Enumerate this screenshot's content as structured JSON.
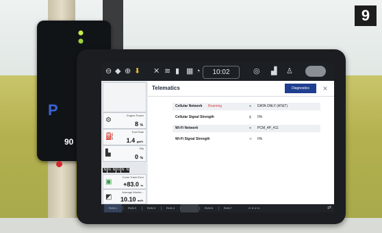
{
  "badge": {
    "number": "9"
  },
  "side_display": {
    "gear": "P",
    "speed": "90"
  },
  "topbar": {
    "icons": [
      "speedometer-icon",
      "info-icon",
      "gps-icon",
      "arrow-down-icon",
      "wrench-icon",
      "wifi-icon",
      "signal-bars-icon",
      "grid-icon",
      "timer-icon"
    ],
    "clock": "10:02"
  },
  "left_panel": {
    "engine_power": {
      "label": "Engine Power",
      "value": "8",
      "unit": "%"
    },
    "fuel_rate": {
      "label": "Fuel Rate",
      "value": "1.4",
      "unit": "gal/h"
    },
    "slip": {
      "label": "Slip",
      "value": "0",
      "unit": "%"
    },
    "gear_row_top": [
      "N",
      "N",
      "N",
      "N",
      "N",
      "N"
    ],
    "gear_row_bottom": [
      "0",
      "0",
      "0",
      "0",
      "0",
      "0"
    ],
    "cross_track_error": {
      "label": "Cross Track Error",
      "value": "+83.0",
      "unit": "in"
    },
    "average_working": {
      "label": "Average Workin...",
      "value": "10.10",
      "unit": "ac/h"
    }
  },
  "main": {
    "title": "Telematics",
    "diagnostics_button": "Diagnostics",
    "rows": [
      {
        "label": "Cellular Network",
        "status": "Roaming",
        "value": "DATA ONLY (AT&T)"
      },
      {
        "label": "Cellular Signal Strength",
        "status": "",
        "value": "0%"
      },
      {
        "label": "Wi-Fi Network",
        "status": "",
        "value": "PCM_4P_411"
      },
      {
        "label": "Wi-Fi Signal Strength",
        "status": "",
        "value": "0%"
      }
    ]
  },
  "bottom_nav": {
    "items": [
      "RUN 1",
      "RUN 2",
      "RUN 3",
      "RUN 4",
      "",
      "RUN 6",
      "RUN 7"
    ],
    "sync": "⇄"
  }
}
